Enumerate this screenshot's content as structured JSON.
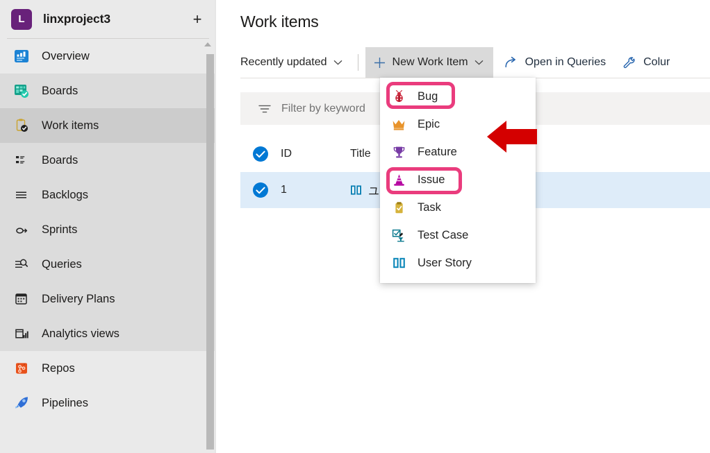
{
  "sidebar": {
    "project": {
      "avatar_letter": "L",
      "name": "linxproject3",
      "add_button_label": "+"
    },
    "items": [
      {
        "label": "Overview",
        "icon": "overview-icon",
        "level": "top",
        "state": "normal"
      },
      {
        "label": "Boards",
        "icon": "boards-hub-icon",
        "level": "top",
        "state": "group"
      },
      {
        "label": "Work items",
        "icon": "work-items-icon",
        "level": "sub",
        "state": "selected"
      },
      {
        "label": "Boards",
        "icon": "boards-grid-icon",
        "level": "sub",
        "state": "group"
      },
      {
        "label": "Backlogs",
        "icon": "backlogs-icon",
        "level": "sub",
        "state": "group"
      },
      {
        "label": "Sprints",
        "icon": "sprints-icon",
        "level": "sub",
        "state": "group"
      },
      {
        "label": "Queries",
        "icon": "queries-icon",
        "level": "sub",
        "state": "group"
      },
      {
        "label": "Delivery Plans",
        "icon": "delivery-plans-icon",
        "level": "sub",
        "state": "group"
      },
      {
        "label": "Analytics views",
        "icon": "analytics-views-icon",
        "level": "sub",
        "state": "group"
      },
      {
        "label": "Repos",
        "icon": "repos-icon",
        "level": "top",
        "state": "normal"
      },
      {
        "label": "Pipelines",
        "icon": "pipelines-icon",
        "level": "top",
        "state": "normal"
      }
    ]
  },
  "main": {
    "page_title": "Work items",
    "toolbar": {
      "view_selector_label": "Recently updated",
      "new_work_item_label": "New Work Item",
      "open_in_queries_label": "Open in Queries",
      "column_options_label": "Colur"
    },
    "filter": {
      "placeholder": "Filter by keyword",
      "value": ""
    },
    "grid": {
      "columns": [
        "ID",
        "Title"
      ],
      "rows": [
        {
          "id": "1",
          "title": "ユー",
          "icon": "user-story-icon",
          "selected": true
        }
      ]
    }
  },
  "menu": {
    "name": "new-work-item-menu",
    "items": [
      {
        "label": "Bug",
        "icon": "bug-icon",
        "highlighted": true
      },
      {
        "label": "Epic",
        "icon": "epic-icon",
        "highlighted": false
      },
      {
        "label": "Feature",
        "icon": "feature-icon",
        "highlighted": false
      },
      {
        "label": "Issue",
        "icon": "issue-icon",
        "highlighted": true
      },
      {
        "label": "Task",
        "icon": "task-icon",
        "highlighted": false
      },
      {
        "label": "Test Case",
        "icon": "test-case-icon",
        "highlighted": false
      },
      {
        "label": "User Story",
        "icon": "user-story-icon",
        "highlighted": false
      }
    ]
  },
  "annotations": {
    "highlight_color": "#ea3c7d",
    "arrow_color": "#d40000",
    "arrow_direction": "left"
  },
  "colors": {
    "project_avatar": "#68217a",
    "sidebar_bg": "#eaeaea",
    "sidebar_selected": "#cccccc",
    "sidebar_group": "#dcdcdc",
    "row_selected": "#deecf9",
    "accent_blue": "#0078d4",
    "toolbar_active_bg": "#dadada"
  }
}
